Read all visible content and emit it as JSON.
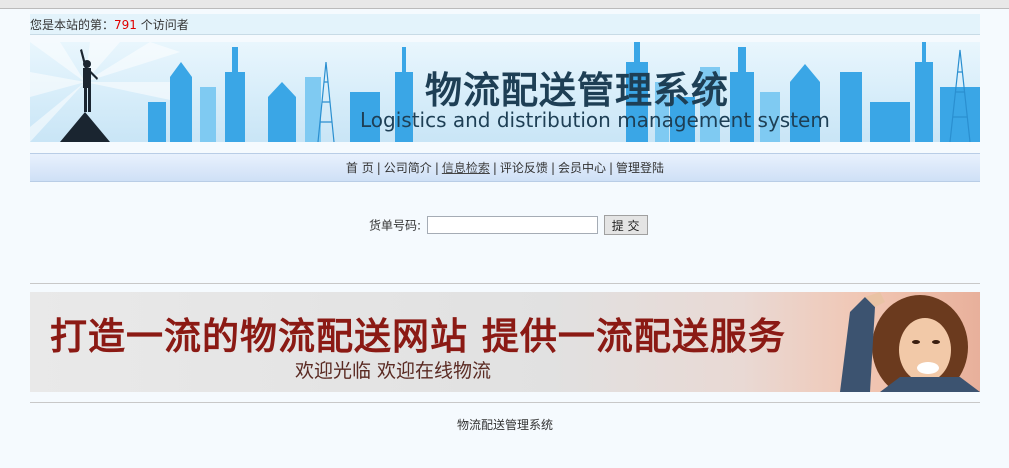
{
  "visitor": {
    "prefix": "您是本站的第：",
    "count": "791",
    "suffix": " 个访问者"
  },
  "banner": {
    "title": "物流配送管理系统",
    "subtitle": "Logistics and distribution management system"
  },
  "nav": {
    "items": [
      {
        "label": "首 页"
      },
      {
        "label": "公司简介"
      },
      {
        "label": "信息检索"
      },
      {
        "label": "评论反馈"
      },
      {
        "label": "会员中心"
      },
      {
        "label": "管理登陆"
      }
    ],
    "separator": "|"
  },
  "search": {
    "label": "货单号码:",
    "value": "",
    "submit": "提 交"
  },
  "promo": {
    "main": "打造一流的物流配送网站 提供一流配送服务",
    "sub": "欢迎光临 欢迎在线物流"
  },
  "footer": {
    "text": "物流配送管理系统"
  }
}
